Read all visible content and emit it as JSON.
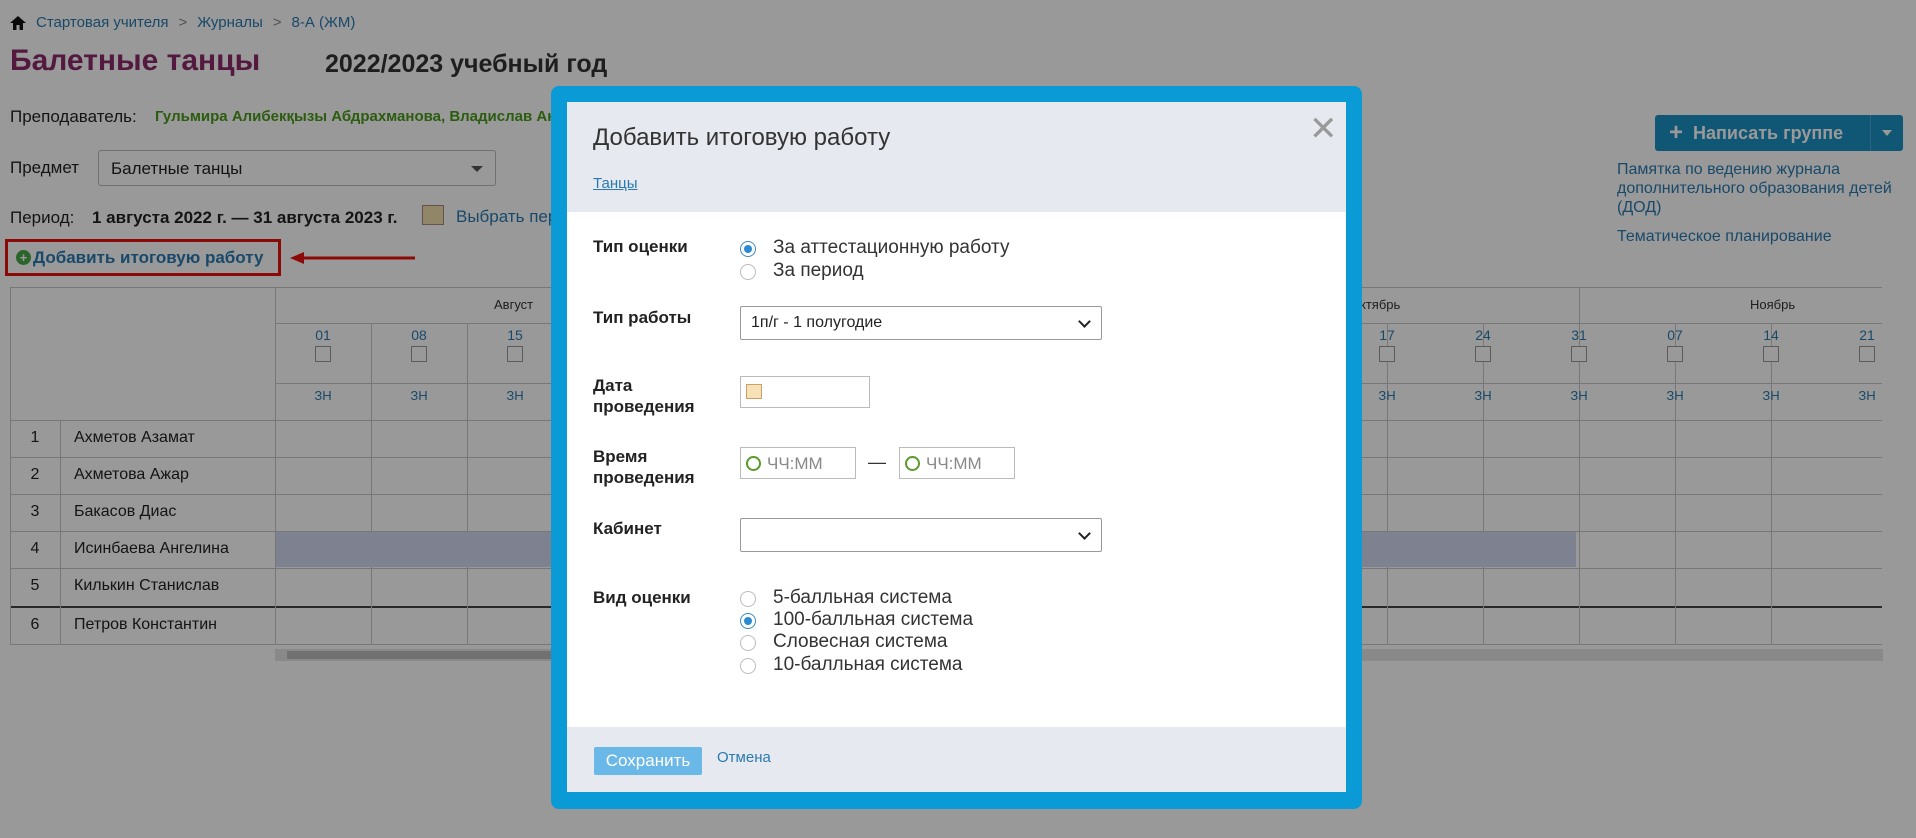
{
  "breadcrumb": {
    "home_icon": "home-icon",
    "items": [
      "Стартовая учителя",
      "Журналы",
      "8-А (ЖМ)"
    ],
    "separator": ">"
  },
  "page": {
    "title": "Балетные танцы",
    "year": "2022/2023 учебный год",
    "teacher_label": "Преподаватель:",
    "teacher_value": "Гульмира Алибекқызы Абдрахманова, Владислав Ан",
    "subject_label": "Предмет",
    "subject_value": "Балетные танцы",
    "period_label": "Период:",
    "period_value": "1 августа 2022 г. — 31 августа 2023 г.",
    "choose_period": "Выбрать пер",
    "add_final_label": "Добавить итоговую работу"
  },
  "right_panel": {
    "send_button": "Написать группе",
    "memo_link": "Памятка по ведению журнала дополнительного образования детей (ДОД)",
    "thematic_link": "Тематическое планирование"
  },
  "journal": {
    "months": [
      "Август",
      "ктябрь",
      "Ноябрь"
    ],
    "left_days": [
      "01",
      "08",
      "15"
    ],
    "right_days": [
      "17",
      "24",
      "31",
      "07",
      "14",
      "21"
    ],
    "grade_label": "ЗН",
    "students": [
      {
        "num": "1",
        "name": "Ахметов Азамат"
      },
      {
        "num": "2",
        "name": "Ахметова Ажар"
      },
      {
        "num": "3",
        "name": "Бакасов Диас"
      },
      {
        "num": "4",
        "name": "Исинбаева Ангелина"
      },
      {
        "num": "5",
        "name": "Килькин Станислав"
      },
      {
        "num": "6",
        "name": "Петров Константин"
      }
    ]
  },
  "modal": {
    "title": "Добавить итоговую работу",
    "subtitle_link": "Танцы",
    "grade_type_label": "Тип оценки",
    "grade_type_options": [
      "За аттестационную работу",
      "За период"
    ],
    "grade_type_selected": "За аттестационную работу",
    "work_type_label": "Тип работы",
    "work_type_value": "1п/г - 1 полугодие",
    "date_label": "Дата проведения",
    "time_label": "Время проведения",
    "time_placeholder": "ЧЧ:ММ",
    "time_separator": "—",
    "room_label": "Кабинет",
    "room_value": "",
    "scale_label": "Вид оценки",
    "scale_options": [
      "5-балльная система",
      "100-балльная система",
      "Словесная система",
      "10-балльная система"
    ],
    "scale_selected": "100-балльная система",
    "save_button": "Сохранить",
    "cancel_link": "Отмена"
  }
}
